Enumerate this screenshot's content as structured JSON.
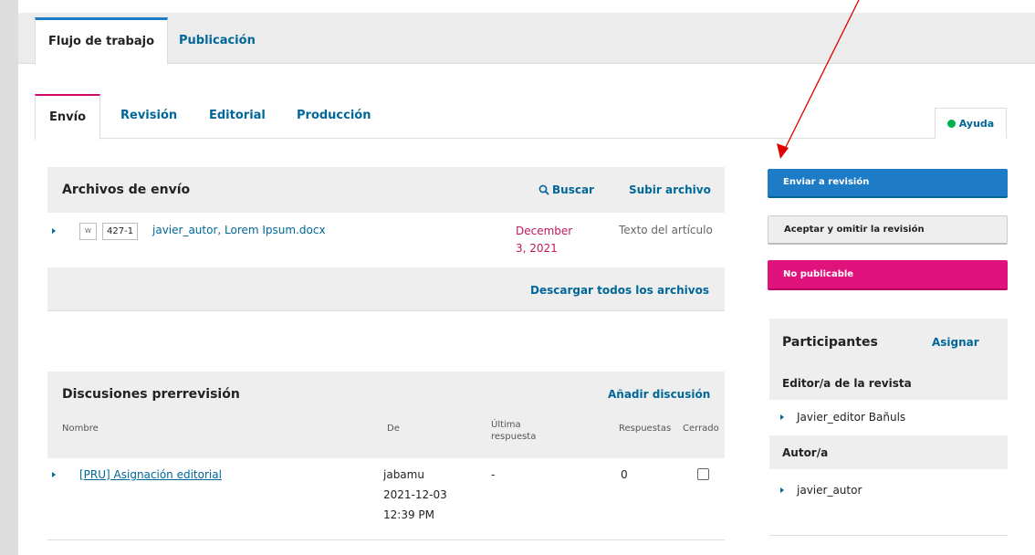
{
  "top_tabs": [
    "Flujo de trabajo",
    "Publicación"
  ],
  "stage_tabs": [
    "Envío",
    "Revisión",
    "Editorial",
    "Producción"
  ],
  "help_label": "Ayuda",
  "files_panel": {
    "title": "Archivos de envío",
    "search_label": "Buscar",
    "upload_label": "Subir archivo",
    "file": {
      "id": "427-1",
      "name": "javier_autor, Lorem Ipsum.docx",
      "date_line1": "December",
      "date_line2": "3, 2021",
      "type": "Texto del artículo"
    },
    "download_all_label": "Descargar todos los archivos"
  },
  "discussions_panel": {
    "title": "Discusiones prerrevisión",
    "add_label": "Añadir discusión",
    "columns": [
      "Nombre",
      "De",
      "Última respuesta",
      "Respuestas",
      "Cerrado"
    ],
    "row": {
      "name": "[PRU] Asignación editorial",
      "from_user": "jabamu",
      "from_date": "2021-12-03",
      "from_time": "12:39 PM",
      "last_reply": "-",
      "replies": "0"
    }
  },
  "actions": {
    "send_review": "Enviar a revisión",
    "accept_skip": "Aceptar y omitir la revisión",
    "decline": "No publicable"
  },
  "participants": {
    "title": "Participantes",
    "assign_label": "Asignar",
    "groups": [
      {
        "name": "Editor/a de la revista",
        "member": "Javier_editor Bañuls"
      },
      {
        "name": "Autor/a",
        "member": "javier_autor"
      }
    ]
  },
  "colors": {
    "link": "#006798",
    "primary": "#1e7bc6",
    "danger": "#e0127b",
    "date": "#c2185b",
    "annotation_arrow": "#e00000"
  }
}
